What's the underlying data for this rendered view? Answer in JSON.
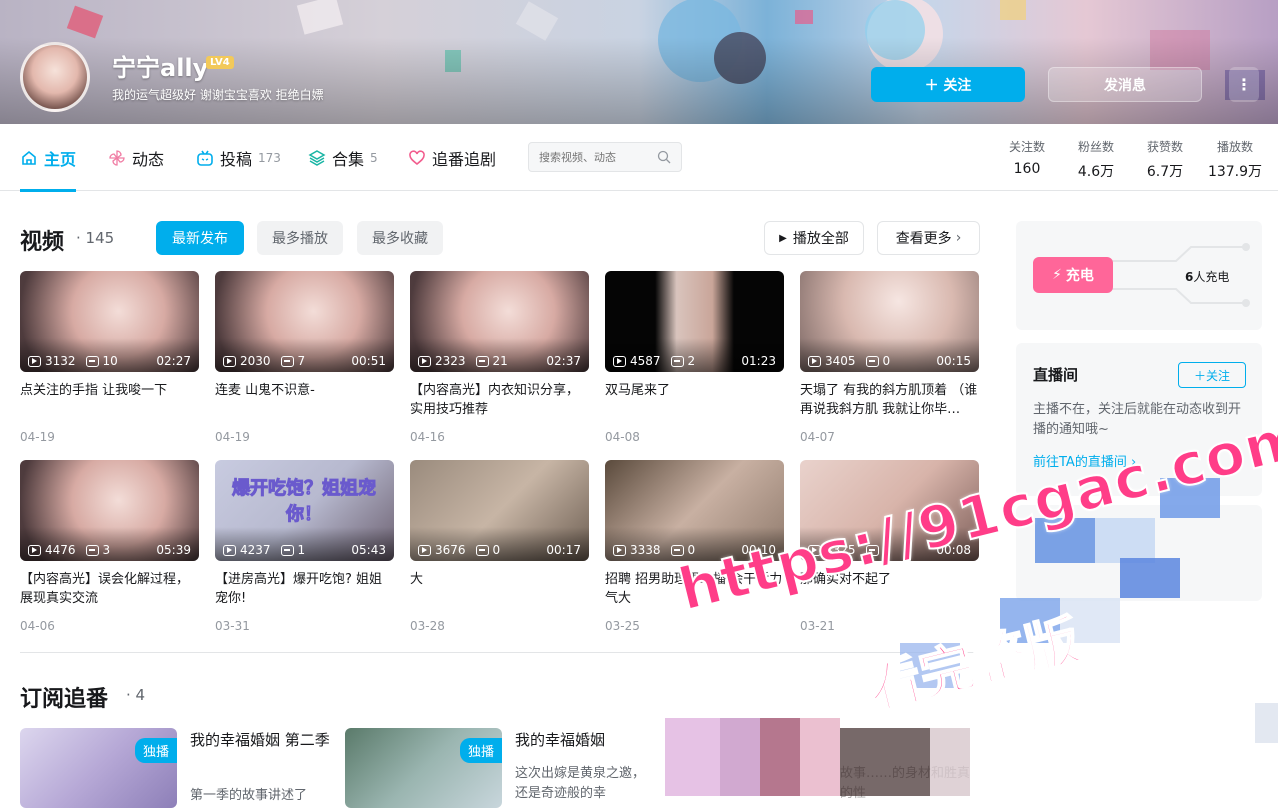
{
  "profile": {
    "name": "宁宁ally",
    "level": "LV4",
    "sign": "我的运气超级好 谢谢宝宝喜欢 拒绝白嫖",
    "follow_label": "＋ 关注",
    "message_label": "发消息",
    "more_label": "⋮"
  },
  "nav": {
    "tabs": [
      {
        "label": "主页",
        "count": ""
      },
      {
        "label": "动态",
        "count": ""
      },
      {
        "label": "投稿",
        "count": "173"
      },
      {
        "label": "合集",
        "count": "5"
      },
      {
        "label": "追番追剧",
        "count": ""
      }
    ],
    "search_placeholder": "搜索视频、动态",
    "stats": [
      {
        "label": "关注数",
        "value": "160"
      },
      {
        "label": "粉丝数",
        "value": "4.6万"
      },
      {
        "label": "获赞数",
        "value": "6.7万"
      },
      {
        "label": "播放数",
        "value": "137.9万"
      }
    ]
  },
  "videos": {
    "title": "视频",
    "count": "145",
    "sort_tabs": [
      "最新发布",
      "最多播放",
      "最多收藏"
    ],
    "play_all": "播放全部",
    "see_more": "查看更多",
    "items": [
      {
        "plays": "3132",
        "danmaku": "10",
        "duration": "02:27",
        "title": "点关注的手指 让我唆一下",
        "date": "04-19"
      },
      {
        "plays": "2030",
        "danmaku": "7",
        "duration": "00:51",
        "title": "连麦 山鬼不识意-",
        "date": "04-19"
      },
      {
        "plays": "2323",
        "danmaku": "21",
        "duration": "02:37",
        "title": "【内容高光】内衣知识分享，实用技巧推荐",
        "date": "04-16"
      },
      {
        "plays": "4587",
        "danmaku": "2",
        "duration": "01:23",
        "title": "双马尾来了",
        "date": "04-08"
      },
      {
        "plays": "3405",
        "danmaku": "0",
        "duration": "00:15",
        "title": "天塌了 有我的斜方肌顶着 （谁再说我斜方肌 我就让你毕…",
        "date": "04-07"
      },
      {
        "plays": "4476",
        "danmaku": "3",
        "duration": "05:39",
        "title": "【内容高光】误会化解过程，展现真实交流",
        "date": "04-06"
      },
      {
        "plays": "4237",
        "danmaku": "1",
        "duration": "05:43",
        "title": "【进房高光】爆开吃饱? 姐姐宠你!",
        "date": "03-31",
        "overlay": "爆开吃饱？姐姐宠你！"
      },
      {
        "plays": "3676",
        "danmaku": "0",
        "duration": "00:17",
        "title": "大",
        "date": "03-28"
      },
      {
        "plays": "3338",
        "danmaku": "0",
        "duration": "00:10",
        "title": "招聘 招男助理男助播 会干活力气大",
        "date": "03-25"
      },
      {
        "plays": "4325",
        "danmaku": "0",
        "duration": "00:08",
        "title": "那确实对不起了",
        "date": "03-21"
      }
    ]
  },
  "charge": {
    "label": "充电",
    "count_prefix": "6",
    "count_suffix": "人充电"
  },
  "live": {
    "title": "直播间",
    "follow_label": "＋关注",
    "desc": "主播不在，关注后就能在动态收到开播的通知哦~",
    "link": "前往TA的直播间 ›"
  },
  "bangumi": {
    "title": "订阅追番",
    "count": "4",
    "items": [
      {
        "badge": "独播",
        "title": "我的幸福婚姻 第二季",
        "desc": "第一季的故事讲述了"
      },
      {
        "badge": "独播",
        "title": "我的幸福婚姻",
        "desc": "这次出嫁是黄泉之邀，还是奇迹般的幸"
      }
    ],
    "partial_desc": "故事……的身材和胜真的性"
  },
  "watermark": {
    "url": "https://91cgac.com",
    "text": "看完整版"
  },
  "colors": {
    "accent": "#00aeec",
    "charge": "#ff6699",
    "watermark": "#ff3d88"
  }
}
